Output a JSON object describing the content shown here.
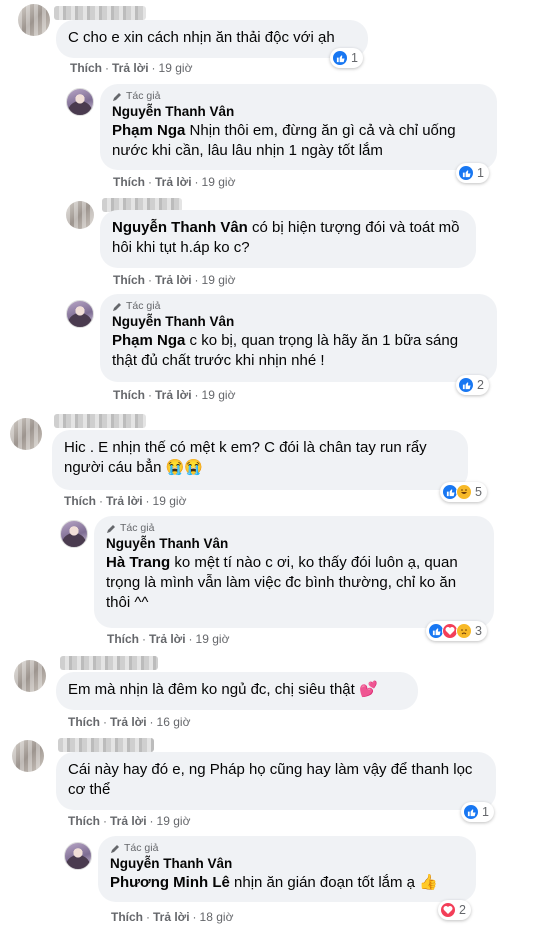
{
  "ui": {
    "like_label": "Thích",
    "reply_label": "Trả lời",
    "author_badge": "Tác giả",
    "colors": {
      "bubble": "#f0f2f5",
      "link": "#65676b",
      "like_blue": "#1877f2"
    }
  },
  "comments": [
    {
      "name": "",
      "text": "C cho e xin cách nhịn ăn thải độc với ạh",
      "time": "19 giờ",
      "reactions": "1",
      "reaction_icons": [
        "like-icon"
      ]
    },
    {
      "name": "Nguyễn Thanh Vân",
      "author": true,
      "mention": "Phạm Nga",
      "text": " Nhịn thôi em, đừng ăn gì cả và chỉ uống nước khi cần, lâu lâu nhịn 1 ngày tốt lắm",
      "time": "19 giờ",
      "reactions": "1",
      "reaction_icons": [
        "like-icon"
      ]
    },
    {
      "name": "",
      "mention": "Nguyễn Thanh Vân",
      "text": " có bị hiện tượng đói và toát mồ hôi khi tụt h.áp ko c?",
      "time": "19 giờ"
    },
    {
      "name": "Nguyễn Thanh Vân",
      "author": true,
      "mention": "Phạm Nga",
      "text": " c ko bị, quan trọng là hãy ăn 1 bữa sáng thật đủ chất trước khi nhịn nhé !",
      "time": "19 giờ",
      "reactions": "2",
      "reaction_icons": [
        "like-icon"
      ]
    },
    {
      "name": "",
      "text": "Hic . E nhịn thế có mệt k em? C đói là chân tay run rẩy người cáu bẳn 😭😭",
      "time": "19 giờ",
      "reactions": "5",
      "reaction_icons": [
        "like-icon",
        "haha-icon"
      ]
    },
    {
      "name": "Nguyễn Thanh Vân",
      "author": true,
      "mention": "Hà Trang",
      "text": " ko mệt tí nào c ơi, ko thấy đói luôn ạ, quan trọng là mình vẫn làm việc đc bình thường, chỉ ko ăn thôi ^^",
      "time": "19 giờ",
      "reactions": "3",
      "reaction_icons": [
        "like-icon",
        "love-icon",
        "sad-icon"
      ]
    },
    {
      "name": "",
      "text": "Em mà nhịn là đêm ko ngủ đc, chị siêu thật 💕",
      "time": "16 giờ"
    },
    {
      "name": "",
      "text": "Cái này hay đó e, ng Pháp họ cũng hay làm vậy để thanh lọc cơ thể",
      "time": "19 giờ",
      "reactions": "1",
      "reaction_icons": [
        "like-icon"
      ]
    },
    {
      "name": "Nguyễn Thanh Vân",
      "author": true,
      "mention": "Phương Minh Lê",
      "text": " nhịn ăn gián đoạn tốt lắm ạ 👍",
      "time": "18 giờ",
      "reactions": "2",
      "reaction_icons": [
        "love-icon"
      ]
    }
  ]
}
